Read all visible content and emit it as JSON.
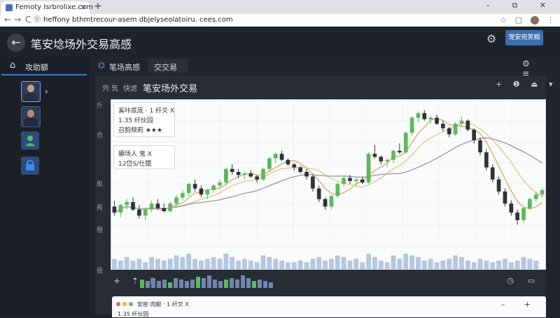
{
  "browser": {
    "tab_title": "Femoty Isrbrolixe.com",
    "url": "heffony bthmtrecour-asem dbjelyseolatoiru. cees.com",
    "tab_close": "×",
    "new_tab": "+",
    "window_controls": "– ⧉ ✕",
    "nav_back": "←",
    "nav_forward": "→",
    "nav_reload": "C",
    "lock": "⓪",
    "star": "☆",
    "menu": "⋮"
  },
  "app": {
    "title": "笔安埝场外交易高感",
    "back_icon": "←",
    "gear_icon": "⚙",
    "primary_button": "宠安宛笑赐"
  },
  "sidebar": {
    "tab_label": "攻助额",
    "home_icon": "⌂",
    "chevron": "›",
    "items": [
      {
        "name": "avatar-1",
        "selected": true
      },
      {
        "name": "avatar-2",
        "selected": false
      },
      {
        "name": "user-green",
        "color": "#3fa35a"
      },
      {
        "name": "lock-blue",
        "color": "#3a7bd5"
      }
    ]
  },
  "main": {
    "tabs": [
      {
        "label": "笔场高感",
        "icon": "⌬"
      },
      {
        "label": "交交易"
      }
    ],
    "tab_right_icons": "⚙ ≡"
  },
  "panel": {
    "header_small_1": "宍 気",
    "header_small_2": "快滤",
    "header_title": "笔安场外交易",
    "header_right": "+ ❶ ⏏ ▾"
  },
  "chart": {
    "y_labels": [
      "斤",
      "仓",
      "舭",
      "羖",
      "程",
      "役"
    ],
    "info_box_1": {
      "line1": "奚咔底厐 · 1 纤爻  ⵝ",
      "line2": "1.35 纤伙园",
      "line3": "召韵频莉 ★★★",
      "rating": 3
    },
    "info_box_2": {
      "line1": "顯场人 鬼 ⵝ",
      "line2": "12岱S/仕闥"
    },
    "colors": {
      "up": "#5cb85c",
      "down": "#2f3338",
      "ma_fast": "#d4b16a",
      "ma_slow": "#9a9fa6",
      "ma_mid": "#e2c98a",
      "volume": "#9db4d6"
    }
  },
  "chart_data": {
    "type": "candlestick",
    "series": [
      {
        "o": 42,
        "h": 46,
        "l": 36,
        "c": 38
      },
      {
        "o": 38,
        "h": 44,
        "l": 35,
        "c": 43
      },
      {
        "o": 43,
        "h": 47,
        "l": 40,
        "c": 45
      },
      {
        "o": 45,
        "h": 48,
        "l": 39,
        "c": 40
      },
      {
        "o": 40,
        "h": 43,
        "l": 34,
        "c": 36
      },
      {
        "o": 36,
        "h": 41,
        "l": 33,
        "c": 40
      },
      {
        "o": 40,
        "h": 46,
        "l": 38,
        "c": 44
      },
      {
        "o": 44,
        "h": 47,
        "l": 40,
        "c": 41
      },
      {
        "o": 41,
        "h": 44,
        "l": 38,
        "c": 39
      },
      {
        "o": 39,
        "h": 45,
        "l": 38,
        "c": 44
      },
      {
        "o": 44,
        "h": 50,
        "l": 42,
        "c": 48
      },
      {
        "o": 48,
        "h": 53,
        "l": 46,
        "c": 51
      },
      {
        "o": 51,
        "h": 58,
        "l": 49,
        "c": 57
      },
      {
        "o": 57,
        "h": 60,
        "l": 52,
        "c": 54
      },
      {
        "o": 54,
        "h": 56,
        "l": 48,
        "c": 50
      },
      {
        "o": 50,
        "h": 54,
        "l": 47,
        "c": 53
      },
      {
        "o": 53,
        "h": 57,
        "l": 51,
        "c": 56
      },
      {
        "o": 56,
        "h": 60,
        "l": 54,
        "c": 58
      },
      {
        "o": 58,
        "h": 68,
        "l": 56,
        "c": 67
      },
      {
        "o": 67,
        "h": 70,
        "l": 63,
        "c": 65
      },
      {
        "o": 65,
        "h": 67,
        "l": 61,
        "c": 63
      },
      {
        "o": 63,
        "h": 65,
        "l": 60,
        "c": 64
      },
      {
        "o": 64,
        "h": 66,
        "l": 61,
        "c": 62
      },
      {
        "o": 62,
        "h": 63,
        "l": 58,
        "c": 60
      },
      {
        "o": 60,
        "h": 68,
        "l": 59,
        "c": 67
      },
      {
        "o": 67,
        "h": 75,
        "l": 65,
        "c": 74
      },
      {
        "o": 74,
        "h": 78,
        "l": 71,
        "c": 77
      },
      {
        "o": 77,
        "h": 79,
        "l": 72,
        "c": 73
      },
      {
        "o": 73,
        "h": 74,
        "l": 69,
        "c": 70
      },
      {
        "o": 70,
        "h": 71,
        "l": 66,
        "c": 68
      },
      {
        "o": 68,
        "h": 69,
        "l": 64,
        "c": 65
      },
      {
        "o": 65,
        "h": 67,
        "l": 60,
        "c": 62
      },
      {
        "o": 62,
        "h": 63,
        "l": 52,
        "c": 54
      },
      {
        "o": 54,
        "h": 56,
        "l": 45,
        "c": 47
      },
      {
        "o": 47,
        "h": 48,
        "l": 40,
        "c": 42
      },
      {
        "o": 42,
        "h": 50,
        "l": 40,
        "c": 49
      },
      {
        "o": 49,
        "h": 58,
        "l": 48,
        "c": 57
      },
      {
        "o": 57,
        "h": 62,
        "l": 55,
        "c": 61
      },
      {
        "o": 61,
        "h": 63,
        "l": 57,
        "c": 59
      },
      {
        "o": 59,
        "h": 61,
        "l": 56,
        "c": 60
      },
      {
        "o": 60,
        "h": 62,
        "l": 57,
        "c": 58
      },
      {
        "o": 58,
        "h": 78,
        "l": 57,
        "c": 77
      },
      {
        "o": 77,
        "h": 83,
        "l": 74,
        "c": 75
      },
      {
        "o": 75,
        "h": 76,
        "l": 70,
        "c": 72
      },
      {
        "o": 72,
        "h": 74,
        "l": 68,
        "c": 73
      },
      {
        "o": 73,
        "h": 80,
        "l": 71,
        "c": 79
      },
      {
        "o": 79,
        "h": 84,
        "l": 77,
        "c": 78
      },
      {
        "o": 78,
        "h": 92,
        "l": 77,
        "c": 91
      },
      {
        "o": 91,
        "h": 102,
        "l": 89,
        "c": 101
      },
      {
        "o": 101,
        "h": 105,
        "l": 98,
        "c": 104
      },
      {
        "o": 104,
        "h": 106,
        "l": 99,
        "c": 100
      },
      {
        "o": 100,
        "h": 102,
        "l": 97,
        "c": 101
      },
      {
        "o": 101,
        "h": 103,
        "l": 96,
        "c": 97
      },
      {
        "o": 97,
        "h": 99,
        "l": 92,
        "c": 94
      },
      {
        "o": 94,
        "h": 95,
        "l": 88,
        "c": 90
      },
      {
        "o": 90,
        "h": 98,
        "l": 89,
        "c": 97
      },
      {
        "o": 97,
        "h": 102,
        "l": 95,
        "c": 99
      },
      {
        "o": 99,
        "h": 100,
        "l": 92,
        "c": 93
      },
      {
        "o": 93,
        "h": 94,
        "l": 84,
        "c": 86
      },
      {
        "o": 86,
        "h": 88,
        "l": 76,
        "c": 78
      },
      {
        "o": 78,
        "h": 80,
        "l": 66,
        "c": 68
      },
      {
        "o": 68,
        "h": 70,
        "l": 58,
        "c": 60
      },
      {
        "o": 60,
        "h": 62,
        "l": 50,
        "c": 52
      },
      {
        "o": 52,
        "h": 54,
        "l": 42,
        "c": 44
      },
      {
        "o": 44,
        "h": 46,
        "l": 36,
        "c": 38
      },
      {
        "o": 38,
        "h": 40,
        "l": 30,
        "c": 33
      },
      {
        "o": 33,
        "h": 42,
        "l": 31,
        "c": 41
      },
      {
        "o": 41,
        "h": 48,
        "l": 40,
        "c": 47
      },
      {
        "o": 47,
        "h": 52,
        "l": 45,
        "c": 50
      },
      {
        "o": 50,
        "h": 55,
        "l": 48,
        "c": 53
      }
    ],
    "volume": [
      6,
      5,
      7,
      5,
      6,
      4,
      7,
      6,
      5,
      6,
      8,
      7,
      9,
      6,
      5,
      6,
      7,
      6,
      9,
      7,
      5,
      6,
      5,
      4,
      8,
      7,
      6,
      5,
      4,
      4,
      5,
      4,
      6,
      7,
      5,
      6,
      8,
      7,
      5,
      6,
      4,
      9,
      7,
      5,
      4,
      8,
      6,
      9,
      8,
      7,
      5,
      6,
      4,
      5,
      6,
      8,
      7,
      5,
      4,
      6,
      5,
      4,
      5,
      6,
      4,
      5,
      7,
      6,
      5
    ],
    "ma_lines": [
      "ma_fast",
      "ma_mid",
      "ma_slow"
    ],
    "y_range": [
      20,
      110
    ]
  },
  "chart_toolbar": {
    "left": "+ ⇡ ⌷",
    "right": "◷ ▭"
  },
  "bottom_window": {
    "line1": "安密 肉靓 · 1 纤爻  ⵝ",
    "line2": "1.35 纤伙园",
    "controls": "– +"
  }
}
